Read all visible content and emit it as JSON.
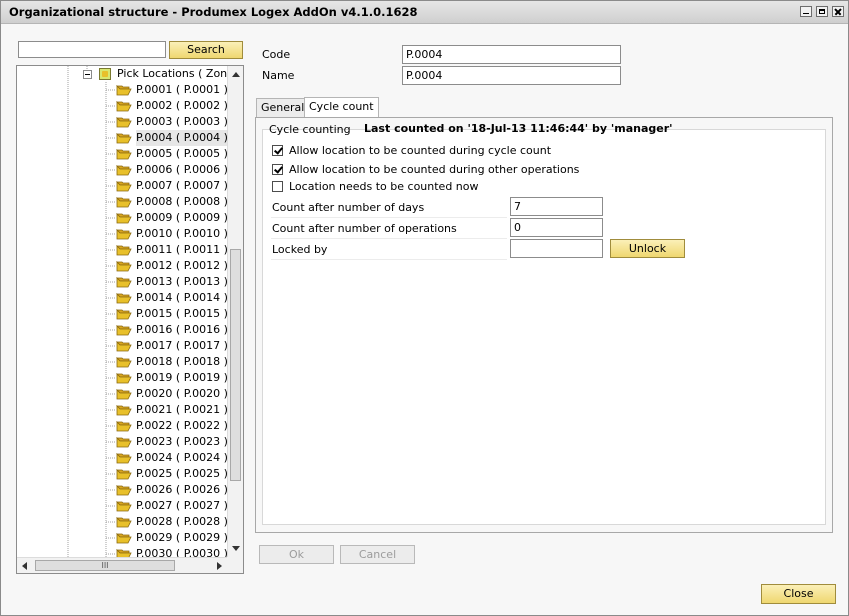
{
  "window": {
    "title": "Organizational structure - Produmex Logex AddOn v4.1.0.1628"
  },
  "search": {
    "value": "",
    "button_label": "Search"
  },
  "tree": {
    "parent_label": "Pick Locations ( ZoneF",
    "items": [
      "P.0001 ( P.0001 )",
      "P.0002 ( P.0002 )",
      "P.0003 ( P.0003 )",
      "P.0004 ( P.0004 )",
      "P.0005 ( P.0005 )",
      "P.0006 ( P.0006 )",
      "P.0007 ( P.0007 )",
      "P.0008 ( P.0008 )",
      "P.0009 ( P.0009 )",
      "P.0010 ( P.0010 )",
      "P.0011 ( P.0011 )",
      "P.0012 ( P.0012 )",
      "P.0013 ( P.0013 )",
      "P.0014 ( P.0014 )",
      "P.0015 ( P.0015 )",
      "P.0016 ( P.0016 )",
      "P.0017 ( P.0017 )",
      "P.0018 ( P.0018 )",
      "P.0019 ( P.0019 )",
      "P.0020 ( P.0020 )",
      "P.0021 ( P.0021 )",
      "P.0022 ( P.0022 )",
      "P.0023 ( P.0023 )",
      "P.0024 ( P.0024 )",
      "P.0025 ( P.0025 )",
      "P.0026 ( P.0026 )",
      "P.0027 ( P.0027 )",
      "P.0028 ( P.0028 )",
      "P.0029 ( P.0029 )",
      "P.0030 ( P.0030 )"
    ],
    "selected_index": 3,
    "hscroll_grip": "III"
  },
  "form": {
    "code_label": "Code",
    "code_value": "P.0004",
    "name_label": "Name",
    "name_value": "P.0004"
  },
  "tabs": {
    "general": "General",
    "cycle_count": "Cycle count",
    "active": "cycle_count"
  },
  "cycle": {
    "group_caption": "Cycle counting",
    "status": "Last counted on '18-Jul-13 11:46:44' by 'manager'",
    "checks": [
      {
        "label": "Allow location to be counted during cycle count",
        "checked": true
      },
      {
        "label": "Allow location to be counted during other operations",
        "checked": true
      },
      {
        "label": "Location needs to be counted now",
        "checked": false
      }
    ],
    "days_label": "Count after number of days",
    "days_value": "7",
    "ops_label": "Count after number of operations",
    "ops_value": "0",
    "locked_label": "Locked by",
    "locked_value": "",
    "unlock_label": "Unlock"
  },
  "buttons": {
    "ok": "Ok",
    "cancel": "Cancel",
    "close": "Close"
  },
  "colors": {
    "yellow_button": "#efd770",
    "selection": "#e6e6e6",
    "folder": "#e8c02a"
  },
  "icons": {
    "tree_item": "folder-icon",
    "tree_parent": "zone-icon"
  }
}
